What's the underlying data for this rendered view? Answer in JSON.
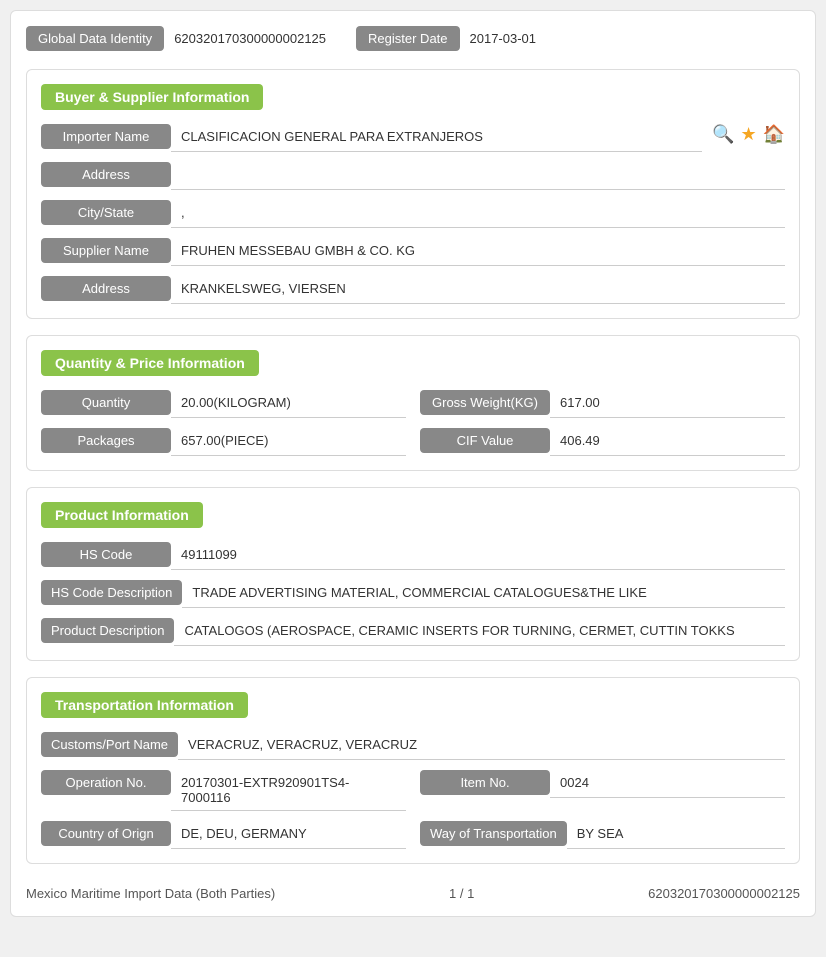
{
  "top": {
    "label": "Global Data Identity",
    "identity_value": "620320170300000002125",
    "register_label": "Register Date",
    "register_value": "2017-03-01"
  },
  "buyer_supplier": {
    "title": "Buyer & Supplier Information",
    "fields": [
      {
        "label": "Importer Name",
        "value": "CLASIFICACION GENERAL PARA EXTRANJEROS",
        "has_icons": true
      },
      {
        "label": "Address",
        "value": ""
      },
      {
        "label": "City/State",
        "value": ","
      },
      {
        "label": "Supplier Name",
        "value": "FRUHEN MESSEBAU GMBH & CO. KG"
      },
      {
        "label": "Address",
        "value": "KRANKELSWEG, VIERSEN"
      }
    ]
  },
  "quantity_price": {
    "title": "Quantity & Price Information",
    "rows": [
      {
        "left_label": "Quantity",
        "left_value": "20.00(KILOGRAM)",
        "right_label": "Gross Weight(KG)",
        "right_value": "617.00"
      },
      {
        "left_label": "Packages",
        "left_value": "657.00(PIECE)",
        "right_label": "CIF Value",
        "right_value": "406.49"
      }
    ]
  },
  "product": {
    "title": "Product Information",
    "fields": [
      {
        "label": "HS Code",
        "value": "49111099"
      },
      {
        "label": "HS Code Description",
        "value": "TRADE ADVERTISING MATERIAL, COMMERCIAL CATALOGUES&THE LIKE"
      },
      {
        "label": "Product Description",
        "value": "CATALOGOS (AEROSPACE, CERAMIC INSERTS FOR TURNING, CERMET, CUTTIN TOKKS"
      }
    ]
  },
  "transportation": {
    "title": "Transportation Information",
    "customs_label": "Customs/Port Name",
    "customs_value": "VERACRUZ, VERACRUZ, VERACRUZ",
    "operation_label": "Operation No.",
    "operation_value": "20170301-EXTR920901TS4-7000116",
    "item_label": "Item No.",
    "item_value": "0024",
    "country_label": "Country of Orign",
    "country_value": "DE, DEU, GERMANY",
    "way_label": "Way of Transportation",
    "way_value": "BY SEA"
  },
  "footer": {
    "left": "Mexico Maritime Import Data (Both Parties)",
    "center": "1 / 1",
    "right": "620320170300000002125"
  }
}
